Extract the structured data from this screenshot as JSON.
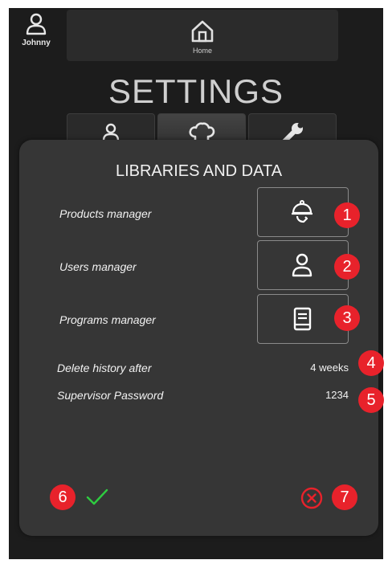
{
  "header": {
    "user_name": "Johnny",
    "home_label": "Home"
  },
  "title": "SETTINGS",
  "tabs": [
    {
      "icon": "user-icon"
    },
    {
      "icon": "chef-hat-icon"
    },
    {
      "icon": "wrench-icon"
    }
  ],
  "panel": {
    "title": "LIBRARIES AND DATA",
    "managers": [
      {
        "label": "Products manager",
        "icon": "cloche-icon"
      },
      {
        "label": "Users manager",
        "icon": "user-icon"
      },
      {
        "label": "Programs manager",
        "icon": "book-icon"
      }
    ],
    "delete_history_label": "Delete history after",
    "delete_history_value": "4 weeks",
    "supervisor_password_label": "Supervisor Password",
    "supervisor_password_value": "1234"
  },
  "badges": [
    "1",
    "2",
    "3",
    "4",
    "5",
    "6",
    "7"
  ],
  "colors": {
    "badge": "#e8222b",
    "confirm": "#2ecc40",
    "cancel": "#e8222b",
    "background": "#1c1c1c",
    "panel": "#363636"
  }
}
